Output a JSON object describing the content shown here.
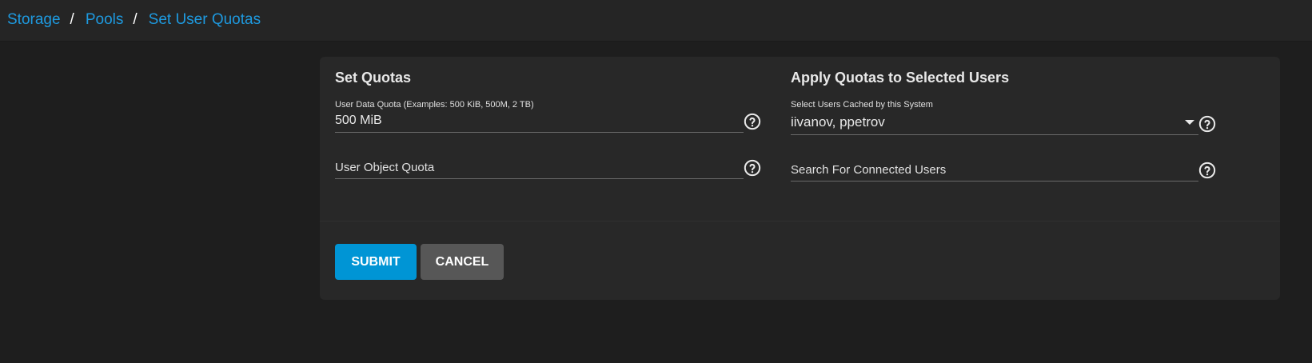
{
  "breadcrumb": {
    "items": [
      "Storage",
      "Pools",
      "Set User Quotas"
    ],
    "separator": "/"
  },
  "set_quotas": {
    "title": "Set Quotas",
    "user_data_quota": {
      "label": "User Data Quota (Examples: 500 KiB, 500M, 2 TB)",
      "value": "500 MiB"
    },
    "user_object_quota": {
      "placeholder": "User Object Quota"
    }
  },
  "apply_quotas": {
    "title": "Apply Quotas to Selected Users",
    "select_users": {
      "label": "Select Users Cached by this System",
      "value": "iivanov, ppetrov"
    },
    "search_users": {
      "placeholder": "Search For Connected Users"
    }
  },
  "actions": {
    "submit_label": "SUBMIT",
    "cancel_label": "CANCEL"
  },
  "colors": {
    "accent": "#0095d5",
    "link": "#1e9ae0",
    "card_bg": "#282828",
    "page_bg": "#1e1e1e",
    "cancel_bg": "#575757"
  },
  "icons": {
    "help": "help-circle-icon",
    "dropdown": "caret-down-icon"
  }
}
